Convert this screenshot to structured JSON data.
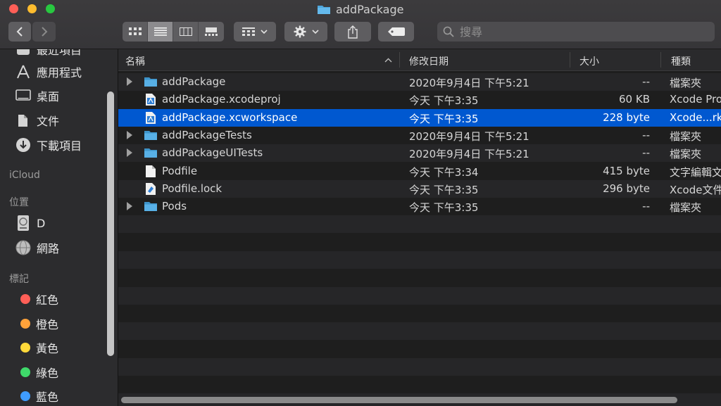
{
  "window": {
    "title": "addPackage"
  },
  "toolbar": {
    "search_placeholder": "搜尋"
  },
  "sidebar": {
    "partial_top": "最近項目",
    "favorites": [
      {
        "label": "應用程式",
        "icon": "applications-icon"
      },
      {
        "label": "桌面",
        "icon": "desktop-icon"
      },
      {
        "label": "文件",
        "icon": "documents-icon"
      },
      {
        "label": "下載項目",
        "icon": "downloads-icon"
      }
    ],
    "icloud_header": "iCloud",
    "locations_header": "位置",
    "locations": [
      {
        "label": "D",
        "icon": "disk-icon"
      },
      {
        "label": "網路",
        "icon": "network-icon"
      }
    ],
    "tags_header": "標記",
    "tags": [
      {
        "label": "紅色",
        "color": "#ff5f57"
      },
      {
        "label": "橙色",
        "color": "#ffa23a"
      },
      {
        "label": "黃色",
        "color": "#ffd93a"
      },
      {
        "label": "綠色",
        "color": "#3fd96a"
      },
      {
        "label": "藍色",
        "color": "#3f9cff"
      }
    ]
  },
  "columns": {
    "name": "名稱",
    "date": "修改日期",
    "size": "大小",
    "kind": "種類"
  },
  "files": [
    {
      "name": "addPackage",
      "date": "2020年9月4日 下午5:21",
      "size": "--",
      "kind": "檔案夾",
      "type": "folder"
    },
    {
      "name": "addPackage.xcodeproj",
      "date": "今天 下午3:35",
      "size": "60 KB",
      "kind": "Xcode Pro",
      "type": "xcode"
    },
    {
      "name": "addPackage.xcworkspace",
      "date": "今天 下午3:35",
      "size": "228 byte",
      "kind": "Xcode...rk",
      "type": "xcode",
      "selected": true
    },
    {
      "name": "addPackageTests",
      "date": "2020年9月4日 下午5:21",
      "size": "--",
      "kind": "檔案夾",
      "type": "folder"
    },
    {
      "name": "addPackageUITests",
      "date": "2020年9月4日 下午5:21",
      "size": "--",
      "kind": "檔案夾",
      "type": "folder"
    },
    {
      "name": "Podfile",
      "date": "今天 下午3:34",
      "size": "415 byte",
      "kind": "文字編輯文",
      "type": "doc"
    },
    {
      "name": "Podfile.lock",
      "date": "今天 下午3:35",
      "size": "296 byte",
      "kind": "Xcode文件",
      "type": "xcodefile"
    },
    {
      "name": "Pods",
      "date": "今天 下午3:35",
      "size": "--",
      "kind": "檔案夾",
      "type": "folder"
    }
  ]
}
